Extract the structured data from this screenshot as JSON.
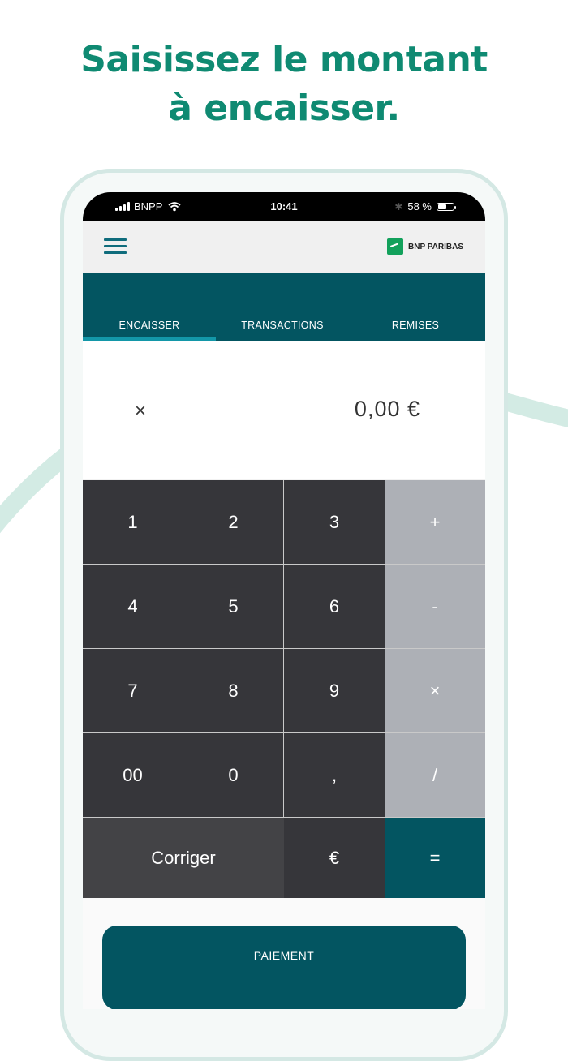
{
  "headline": {
    "line1": "Saisissez le montant",
    "line2": "à encaisser."
  },
  "statusbar": {
    "carrier": "BNPP",
    "time": "10:41",
    "battery": "58 %",
    "battery_level": 0.58
  },
  "appbar": {
    "menu_icon": "hamburger-icon",
    "brand": "BNP PARIBAS"
  },
  "tabs": [
    {
      "label": "ENCAISSER",
      "active": true
    },
    {
      "label": "TRANSACTIONS",
      "active": false
    },
    {
      "label": "REMISES",
      "active": false
    }
  ],
  "display": {
    "clear": "×",
    "amount": "0,00 €"
  },
  "keypad": {
    "k1": "1",
    "k2": "2",
    "k3": "3",
    "plus": "+",
    "k4": "4",
    "k5": "5",
    "k6": "6",
    "minus": "-",
    "k7": "7",
    "k8": "8",
    "k9": "9",
    "times": "×",
    "k00": "00",
    "k0": "0",
    "comma": ",",
    "divide": "/",
    "correct": "Corriger",
    "euro": "€",
    "equals": "="
  },
  "payment": {
    "label": "PAIEMENT"
  },
  "colors": {
    "headline": "#0f8a72",
    "primary": "#035561",
    "accent": "#1397a8",
    "key_dark": "#36363a",
    "key_grey": "#adb0b6"
  }
}
